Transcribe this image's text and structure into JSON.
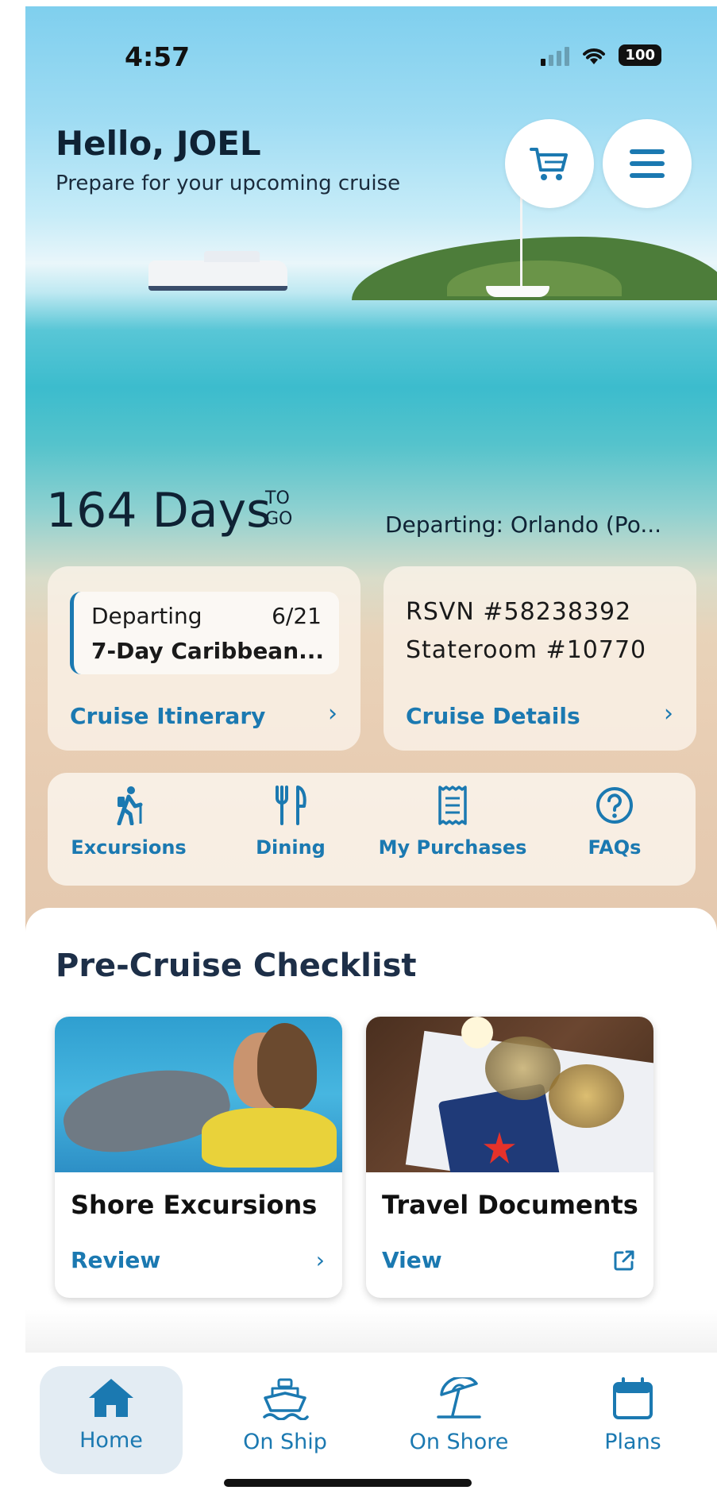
{
  "status_bar": {
    "time": "4:57",
    "battery": "100",
    "icons": [
      "cellular-signal-icon",
      "wifi-icon",
      "battery-icon"
    ]
  },
  "header": {
    "greeting": "Hello, JOEL",
    "subtitle": "Prepare for your upcoming cruise",
    "cart_icon": "cart-icon",
    "menu_icon": "hamburger-menu-icon"
  },
  "countdown": {
    "days": "164 Days",
    "to": "TO",
    "go": "GO",
    "departing_port": "Departing: Orlando (Po..."
  },
  "itinerary_card": {
    "departing_label": "Departing",
    "departing_date": "6/21",
    "cruise_name": "7-Day Caribbean...",
    "link_label": "Cruise Itinerary",
    "chevron": "›"
  },
  "details_card": {
    "rsvn": "RSVN #58238392",
    "stateroom": "Stateroom #10770",
    "link_label": "Cruise Details",
    "chevron": "›"
  },
  "quick_actions": [
    {
      "label": "Excursions",
      "icon": "hiker-icon"
    },
    {
      "label": "Dining",
      "icon": "fork-knife-icon"
    },
    {
      "label": "My Purchases",
      "icon": "receipt-icon"
    },
    {
      "label": "FAQs",
      "icon": "question-circle-icon"
    }
  ],
  "checklist": {
    "title": "Pre-Cruise Checklist",
    "cards": [
      {
        "title": "Shore Excursions",
        "link_label": "Review",
        "link_icon": "chevron-right-icon",
        "chevron": "›"
      },
      {
        "title": "Travel Documents",
        "link_label": "View",
        "link_icon": "external-link-icon"
      }
    ]
  },
  "tabbar": {
    "active": "Home",
    "tabs": [
      {
        "label": "Home",
        "icon": "home-icon"
      },
      {
        "label": "On Ship",
        "icon": "ship-icon"
      },
      {
        "label": "On Shore",
        "icon": "beach-umbrella-icon"
      },
      {
        "label": "Plans",
        "icon": "calendar-icon"
      }
    ]
  },
  "colors": {
    "accent": "#1b79b1",
    "heading": "#1d2f48",
    "active_tab_bg": "#e3ecf3"
  }
}
